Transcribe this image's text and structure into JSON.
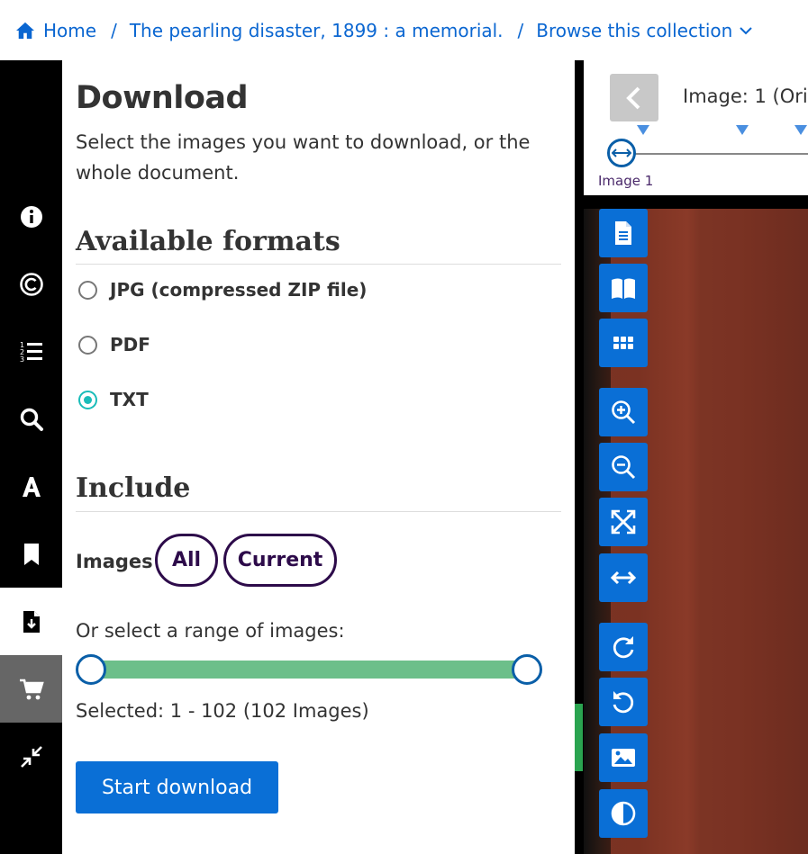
{
  "breadcrumb": {
    "home": "Home",
    "document": "The pearling disaster, 1899 : a memorial.",
    "browse": "Browse this collection"
  },
  "rail": {
    "items": [
      "info-icon",
      "copyright-icon",
      "ordered-list-icon",
      "search-icon",
      "font-icon",
      "bookmark-icon",
      "file-download-icon",
      "cart-icon",
      "compress-icon"
    ],
    "active": "file-download-icon"
  },
  "download": {
    "title": "Download",
    "intro": "Select the images you want to download, or the whole document.",
    "formats_heading": "Available formats",
    "formats": [
      {
        "label": "JPG (compressed ZIP file)",
        "checked": false
      },
      {
        "label": "PDF",
        "checked": false
      },
      {
        "label": "TXT",
        "checked": true
      }
    ],
    "include_heading": "Include",
    "images_label": "Images",
    "all_label": "All",
    "current_label": "Current",
    "range_label": "Or select a range of images:",
    "range": {
      "min": 1,
      "max": 102,
      "from": 1,
      "to": 102
    },
    "selected_text": "Selected: 1 - 102 (102 Images)",
    "start_label": "Start download"
  },
  "viewer": {
    "image_title": "Image: 1 (Orig",
    "timeline_label": "Image  1",
    "tools": [
      "document-icon",
      "book-icon",
      "grid-icon",
      "zoom-in-icon",
      "zoom-out-icon",
      "fullscreen-icon",
      "fit-width-icon",
      "rotate-right-icon",
      "rotate-left-icon",
      "image-icon",
      "contrast-icon"
    ]
  },
  "colors": {
    "link": "#0a66d1",
    "accent": "#0a6fd6",
    "radio_checked": "#1abcb9",
    "pill_border": "#2d0b4a",
    "slider_track": "#6cbf8a"
  }
}
